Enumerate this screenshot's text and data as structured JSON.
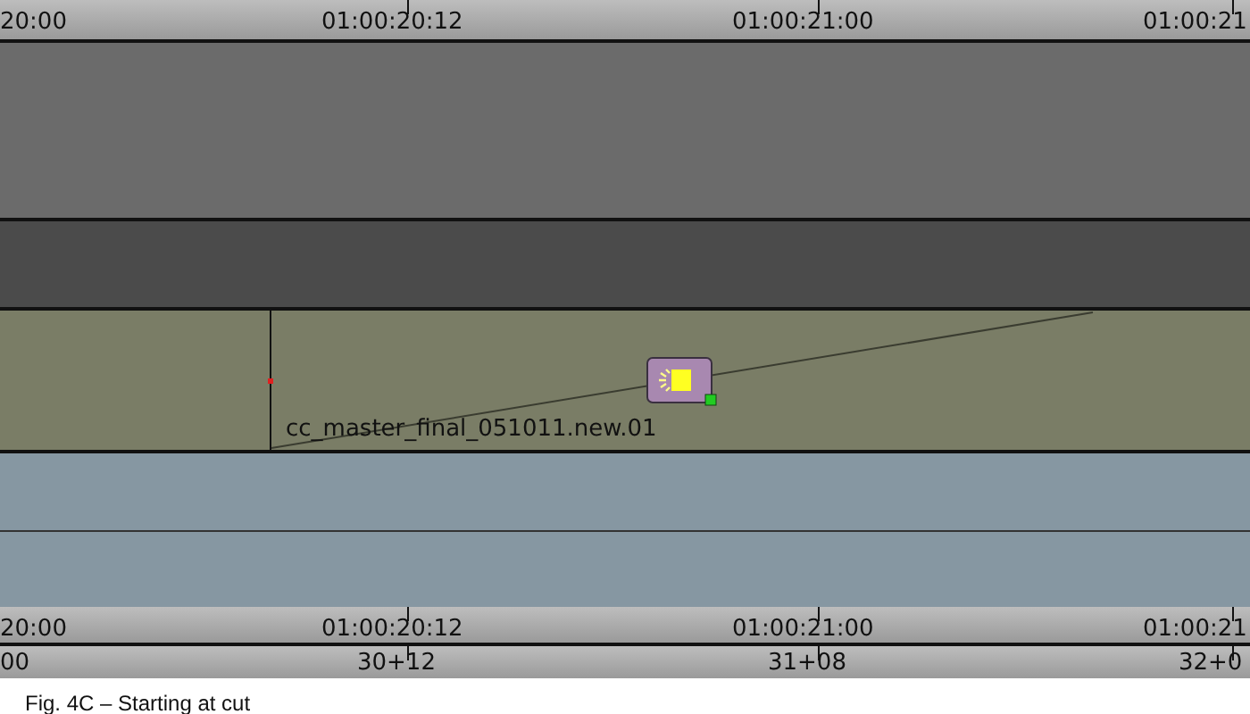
{
  "timecode_ruler_top": {
    "labels": [
      "20:00",
      "01:00:20:12",
      "01:00:21:00",
      "01:00:21"
    ]
  },
  "clip": {
    "name": "cc_master_final_051011.new.01"
  },
  "timecode_ruler_bottom": {
    "labels": [
      "20:00",
      "01:00:20:12",
      "01:00:21:00",
      "01:00:21"
    ]
  },
  "footage_ruler": {
    "labels": [
      "00",
      "30+12",
      "31+08",
      "32+0"
    ]
  },
  "caption": "Fig. 4C – Starting at cut"
}
